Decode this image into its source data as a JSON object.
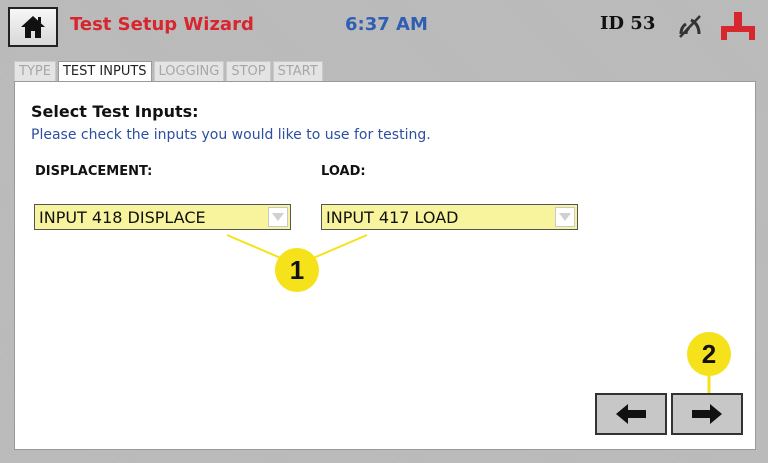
{
  "header": {
    "title": "Test Setup Wizard",
    "time": "6:37 AM",
    "station_id": "ID 53",
    "home_icon": "home-icon",
    "signal_icon": "wireless-off-icon",
    "usb_icon": "usb-icon",
    "colors": {
      "title": "#d7262e",
      "time": "#2f5fb4",
      "usb": "#d7262e"
    }
  },
  "tabs": [
    {
      "label": "TYPE",
      "active": false
    },
    {
      "label": "TEST INPUTS",
      "active": true
    },
    {
      "label": "LOGGING",
      "active": false
    },
    {
      "label": "STOP",
      "active": false
    },
    {
      "label": "START",
      "active": false
    }
  ],
  "panel": {
    "heading": "Select Test Inputs:",
    "instruction": "Please check the inputs you would like to use for testing.",
    "displacement": {
      "label": "DISPLACEMENT:",
      "value": "INPUT 418 DISPLACE"
    },
    "load": {
      "label": "LOAD:",
      "value": "INPUT 417 LOAD"
    },
    "dropdown_color": "#f7f49d"
  },
  "callouts": {
    "one": "1",
    "two": "2",
    "color": "#f5e21a"
  },
  "nav": {
    "back_icon": "arrow-left-icon",
    "next_icon": "arrow-right-icon"
  }
}
